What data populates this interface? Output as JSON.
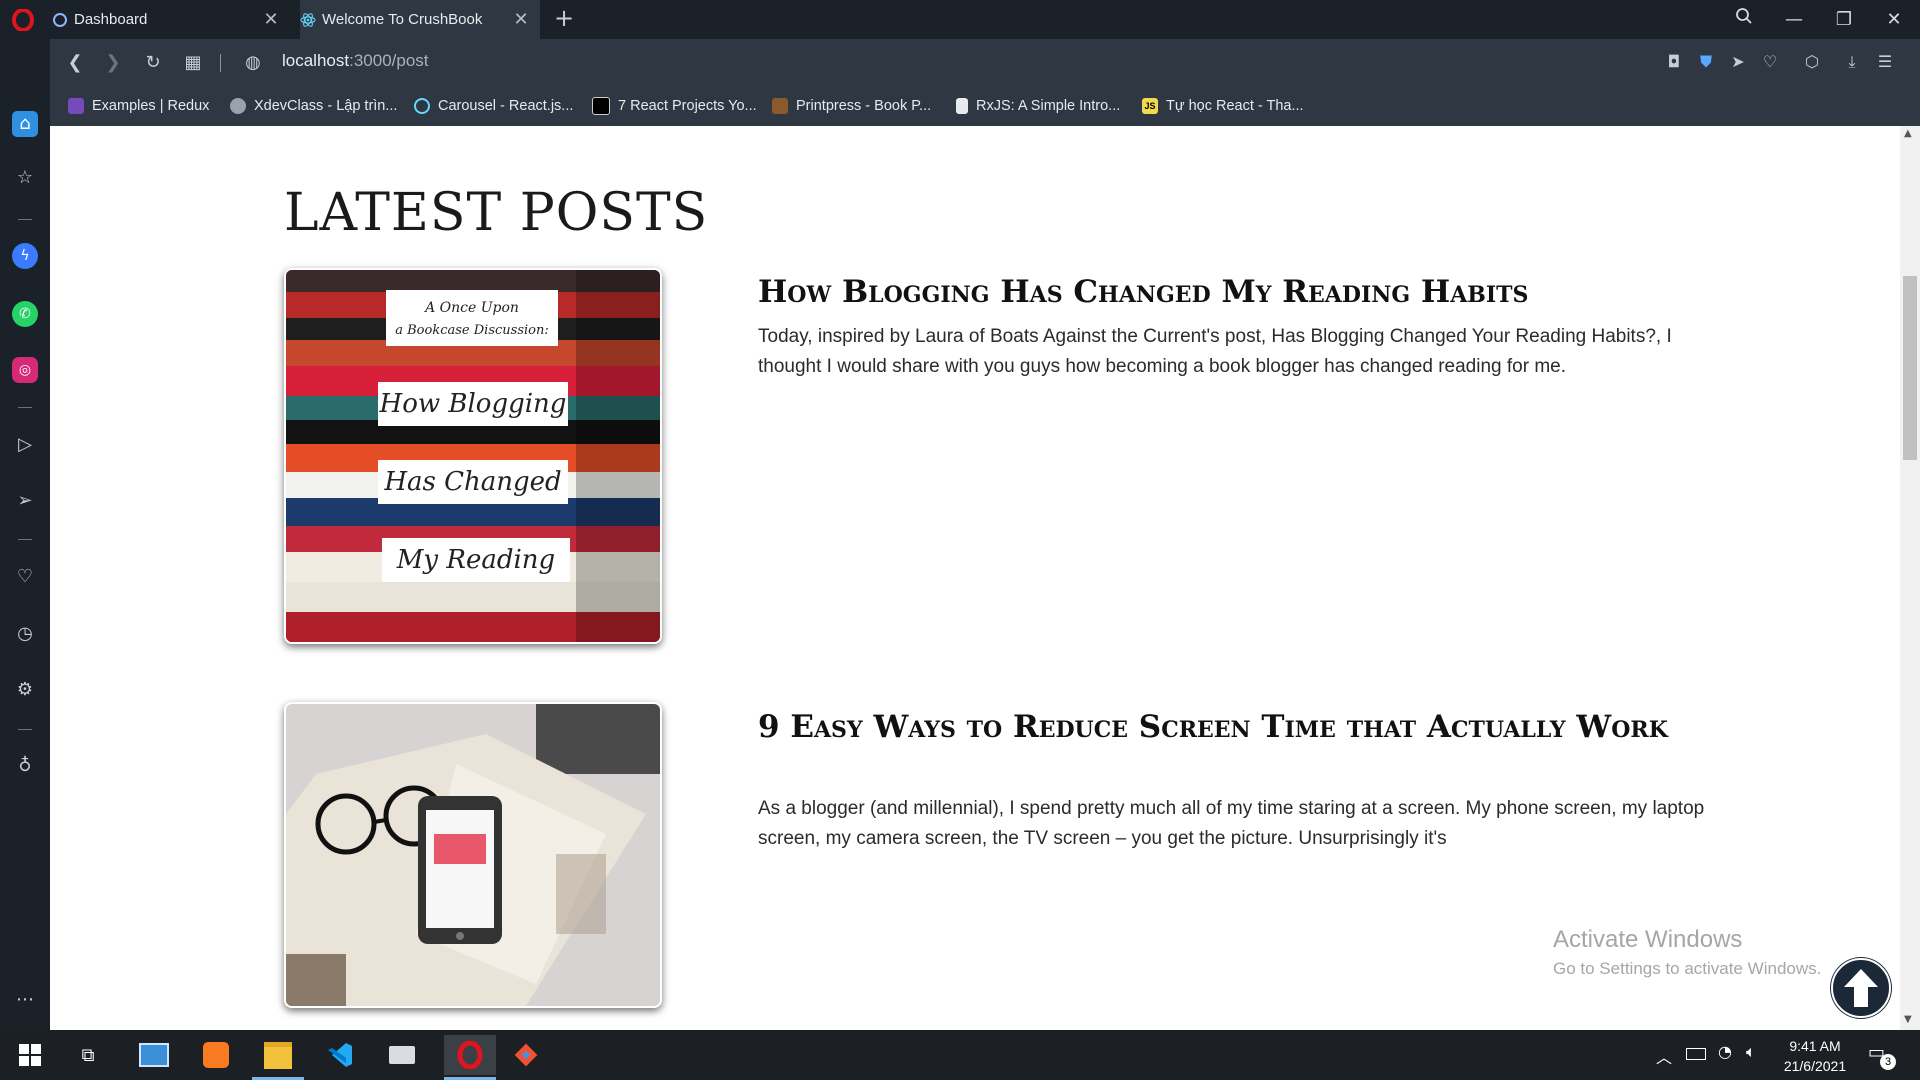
{
  "browser": {
    "tabs": [
      {
        "label": "Dashboard"
      },
      {
        "label": "Welcome To CrushBook"
      }
    ],
    "url_host": "localhost",
    "url_path": ":3000/post",
    "bookmarks": [
      {
        "label": "Examples | Redux"
      },
      {
        "label": "XdevClass - Lập trìn..."
      },
      {
        "label": "Carousel - React.js..."
      },
      {
        "label": "7 React Projects Yo..."
      },
      {
        "label": "Printpress - Book P..."
      },
      {
        "label": "RxJS: A Simple Intro..."
      },
      {
        "label": "Tự học React - Tha..."
      }
    ],
    "bookmark_js_badge": "JS"
  },
  "page": {
    "section_title": "LATEST POSTS",
    "posts": [
      {
        "title": "How Blogging Has Changed My Reading Habits",
        "excerpt": "Today, inspired by Laura of Boats Against the Current's post, Has Blogging Changed Your Reading Habits?, I thought I would share with you guys how becoming a book blogger has changed reading for me.",
        "image_caption": [
          "A Once Upon",
          "a Bookcase Discussion:",
          "How Blogging",
          "Has Changed",
          "My Reading"
        ]
      },
      {
        "title": "9 Easy Ways to Reduce Screen Time that Actually Work",
        "excerpt": "As a blogger (and millennial), I spend pretty much all of my time staring at a screen. My phone screen, my laptop screen, my camera screen, the TV screen – you get the picture. Unsurprisingly it's"
      }
    ]
  },
  "watermark": {
    "line1": "Activate Windows",
    "line2": "Go to Settings to activate Windows."
  },
  "taskbar": {
    "time": "9:41 AM",
    "date": "21/6/2021",
    "notification_count": "3"
  },
  "colors": {
    "browser_dark": "#1b2129",
    "browser_bar": "#2e3742",
    "accent_opera": "#e0141e",
    "scroll_top_button": "#1b2838"
  }
}
